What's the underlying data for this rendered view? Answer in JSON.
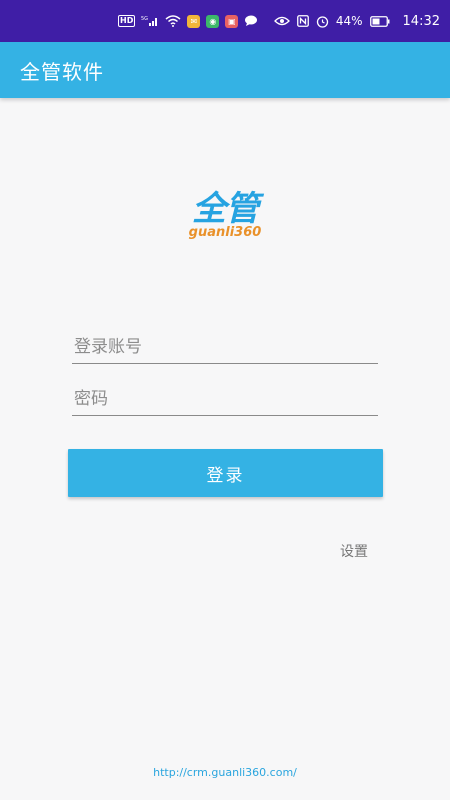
{
  "status_bar": {
    "hd_label": "HD",
    "network_label": "5G",
    "battery_percent": "44%",
    "time": "14:32",
    "icons": [
      "hd-badge",
      "signal-icon",
      "wifi-icon",
      "notification-app-icons",
      "eye-icon",
      "nfc-icon",
      "alarm-icon",
      "battery-icon"
    ]
  },
  "app_bar": {
    "title": "全管软件"
  },
  "logo": {
    "mark": "全管",
    "text": "guanli360"
  },
  "form": {
    "account_placeholder": "登录账号",
    "account_value": "",
    "password_placeholder": "密码",
    "password_value": "",
    "login_label": "登录",
    "settings_label": "设置"
  },
  "footer": {
    "url": "http://crm.guanli360.com/"
  },
  "colors": {
    "status_bar": "#3f1ea6",
    "accent": "#34b2e4",
    "logo_blue": "#26a3e1",
    "logo_orange": "#e9912a"
  }
}
